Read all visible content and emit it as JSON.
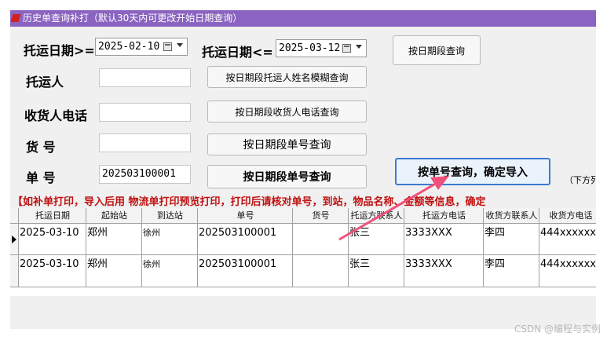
{
  "window": {
    "title": "历史单查询补打（默认30天内可更改开始日期查询）"
  },
  "labels": {
    "ship_date_from": "托运日期>=",
    "ship_date_to": "托运日期<=",
    "shipper": "托运人",
    "receiver_phone": "收货人电话",
    "cargo_no": "货    号",
    "order_no": "单    号"
  },
  "fields": {
    "date_from": "2025-02-10",
    "date_to": "2025-03-12",
    "shipper": "",
    "receiver_phone": "",
    "cargo_no": "",
    "order_no": "202503100001"
  },
  "buttons": {
    "by_date": "按日期段查询",
    "by_shipper": "按日期段托运人姓名模糊查询",
    "by_receiver_phone": "按日期段收货人电话查询",
    "by_cargo_no": "按日期段单号查询",
    "by_order_no": "按日期段单号查询",
    "query_import": "按单号查询，确定导入"
  },
  "note_right": "（下方列",
  "notice": "【如补单打印，导入后用 物流单打印预览打印，打印后请核对单号，到站，物品名称、金额等信息，确定",
  "table": {
    "columns": [
      "托运日期",
      "起始站",
      "到达站",
      "单号",
      "货号",
      "托运方联系人",
      "托运方电话",
      "收货方联系人",
      "收货方电话"
    ],
    "rows": [
      [
        "2025-03-10",
        "郑州",
        "徐州",
        "202503100001",
        "",
        "张三",
        "3333XXX",
        "李四",
        "444xxxxxx"
      ],
      [
        "2025-03-10",
        "郑州",
        "徐州",
        "202503100001",
        "",
        "张三",
        "3333XXX",
        "李四",
        "444xxxxxx"
      ]
    ]
  },
  "colors": {
    "title_bar": "#8a64c0",
    "notice": "#c01010",
    "arrow": "#f0507a"
  },
  "watermark": "CSDN @编程与实例"
}
